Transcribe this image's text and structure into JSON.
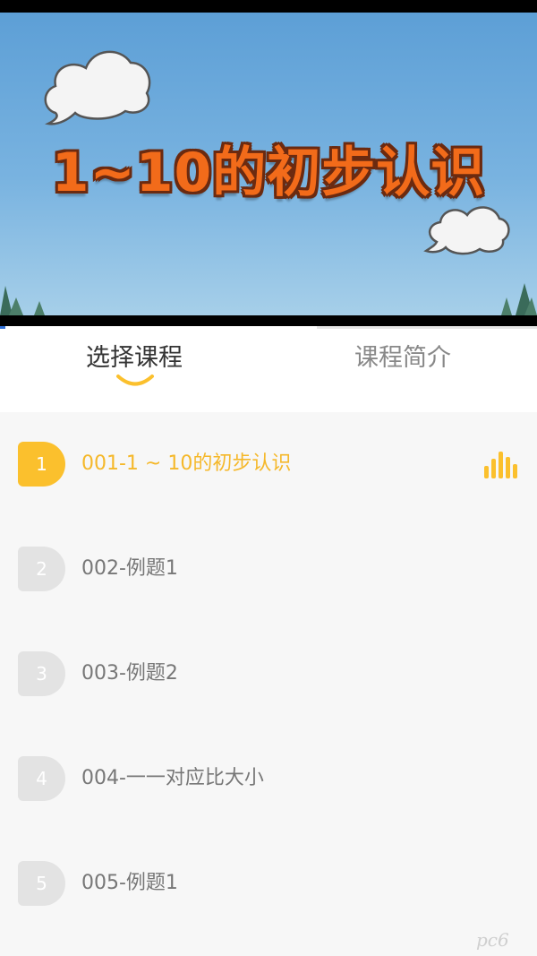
{
  "video": {
    "title": "1~10的初步认识",
    "progress_fraction": 0.59
  },
  "tabs": [
    {
      "label": "选择课程",
      "active": true
    },
    {
      "label": "课程简介",
      "active": false
    }
  ],
  "lessons": [
    {
      "number": "1",
      "title": "001-1 ~ 10的初步认识",
      "active": true
    },
    {
      "number": "2",
      "title": "002-例题1",
      "active": false
    },
    {
      "number": "3",
      "title": "003-例题2",
      "active": false
    },
    {
      "number": "4",
      "title": "004-一一对应比大小",
      "active": false
    },
    {
      "number": "5",
      "title": "005-例题1",
      "active": false
    }
  ],
  "icons": {
    "playing": "audio-bars-icon",
    "tab_indicator": "smile-underline-icon"
  },
  "colors": {
    "accent": "#fbc02d",
    "accent_text": "#f5b82a",
    "inactive_badge": "#e3e3e3",
    "title_orange": "#f26b1a"
  },
  "watermark": "pc6"
}
